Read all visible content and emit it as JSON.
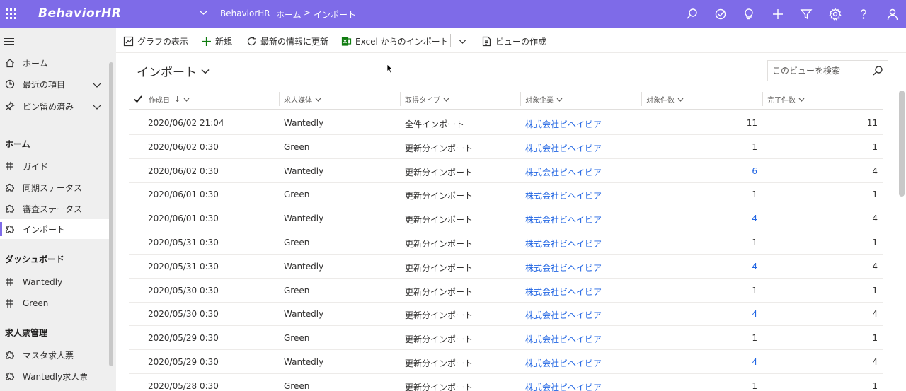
{
  "topbar": {
    "app_name": "BehaviorHR",
    "breadcrumb": {
      "app": "BehaviorHR",
      "home": "ホーム",
      "separator": ">",
      "current": "インポート"
    },
    "icons": [
      "search-icon",
      "task-check-icon",
      "lightbulb-icon",
      "plus-icon",
      "filter-icon",
      "gear-icon",
      "help-icon",
      "user-icon"
    ]
  },
  "sidebar": {
    "top_items": [
      {
        "label": "ホーム",
        "icon": "home-icon"
      },
      {
        "label": "最近の項目",
        "icon": "clock-icon"
      },
      {
        "label": "ピン留め済み",
        "icon": "pin-icon"
      }
    ],
    "groups": [
      {
        "title": "ホーム",
        "items": [
          {
            "label": "ガイド",
            "icon": "grid-icon"
          },
          {
            "label": "同期ステータス",
            "icon": "puzzle-icon"
          },
          {
            "label": "審査ステータス",
            "icon": "puzzle-icon"
          },
          {
            "label": "インポート",
            "icon": "puzzle-icon",
            "active": true
          }
        ]
      },
      {
        "title": "ダッシュボード",
        "items": [
          {
            "label": "Wantedly",
            "icon": "grid-icon"
          },
          {
            "label": "Green",
            "icon": "grid-icon"
          }
        ]
      },
      {
        "title": "求人票管理",
        "items": [
          {
            "label": "マスタ求人票",
            "icon": "puzzle-icon"
          },
          {
            "label": "Wantedly求人票",
            "icon": "puzzle-icon"
          }
        ]
      }
    ]
  },
  "commands": {
    "show_chart": "グラフの表示",
    "new": "新規",
    "refresh": "最新の情報に更新",
    "excel_import": "Excel からのインポート",
    "create_view": "ビューの作成"
  },
  "view": {
    "title": "インポート",
    "search_placeholder": "このビューを検索"
  },
  "table": {
    "columns": [
      "作成日",
      "求人媒体",
      "取得タイプ",
      "対象企業",
      "対象件数",
      "完了件数"
    ],
    "sort_arrow": "↓",
    "rows": [
      {
        "date": "2020/06/02 21:04",
        "media": "Wantedly",
        "type": "全件インポート",
        "company": "株式会社ビヘイビア",
        "target": "11",
        "done": "11"
      },
      {
        "date": "2020/06/02 0:30",
        "media": "Green",
        "type": "更新分インポート",
        "company": "株式会社ビヘイビア",
        "target": "1",
        "done": "1"
      },
      {
        "date": "2020/06/02 0:30",
        "media": "Wantedly",
        "type": "更新分インポート",
        "company": "株式会社ビヘイビア",
        "target": "6",
        "done": "4"
      },
      {
        "date": "2020/06/01 0:30",
        "media": "Green",
        "type": "更新分インポート",
        "company": "株式会社ビヘイビア",
        "target": "1",
        "done": "1"
      },
      {
        "date": "2020/06/01 0:30",
        "media": "Wantedly",
        "type": "更新分インポート",
        "company": "株式会社ビヘイビア",
        "target": "4",
        "done": "4"
      },
      {
        "date": "2020/05/31 0:30",
        "media": "Green",
        "type": "更新分インポート",
        "company": "株式会社ビヘイビア",
        "target": "1",
        "done": "1"
      },
      {
        "date": "2020/05/31 0:30",
        "media": "Wantedly",
        "type": "更新分インポート",
        "company": "株式会社ビヘイビア",
        "target": "4",
        "done": "4"
      },
      {
        "date": "2020/05/30 0:30",
        "media": "Green",
        "type": "更新分インポート",
        "company": "株式会社ビヘイビア",
        "target": "1",
        "done": "1"
      },
      {
        "date": "2020/05/30 0:30",
        "media": "Wantedly",
        "type": "更新分インポート",
        "company": "株式会社ビヘイビア",
        "target": "4",
        "done": "4"
      },
      {
        "date": "2020/05/29 0:30",
        "media": "Green",
        "type": "更新分インポート",
        "company": "株式会社ビヘイビア",
        "target": "1",
        "done": "1"
      },
      {
        "date": "2020/05/29 0:30",
        "media": "Wantedly",
        "type": "更新分インポート",
        "company": "株式会社ビヘイビア",
        "target": "4",
        "done": "4"
      },
      {
        "date": "2020/05/28 0:30",
        "media": "Green",
        "type": "更新分インポート",
        "company": "株式会社ビヘイビア",
        "target": "1",
        "done": "1"
      }
    ]
  },
  "colors": {
    "topbar": "#7e6be8",
    "link": "#2266e3",
    "sidebar_bg": "#efefef"
  }
}
